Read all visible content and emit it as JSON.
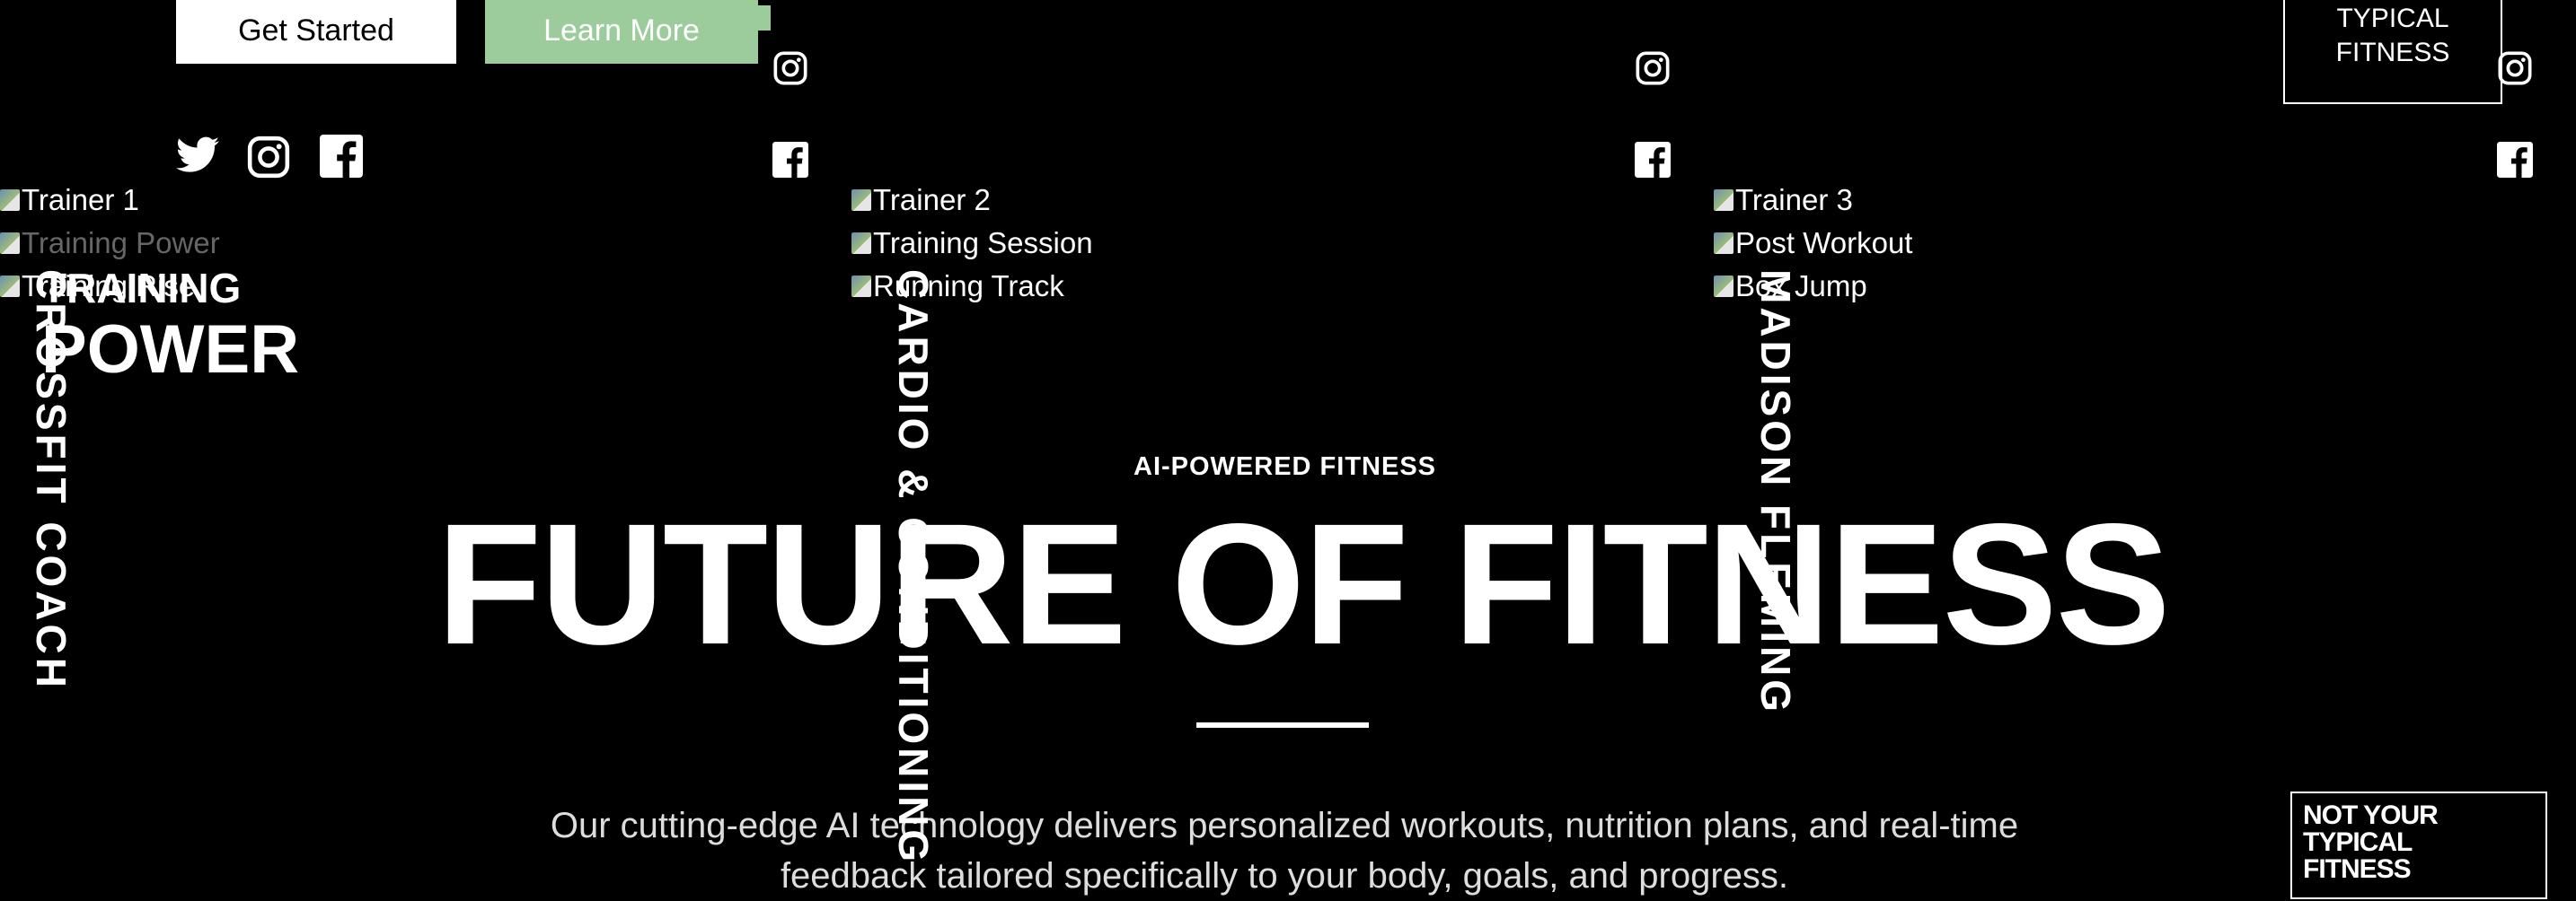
{
  "buttons": {
    "primary_label": "Get Started",
    "secondary_label": "Learn More"
  },
  "social_icons": [
    "twitter-icon",
    "instagram-icon",
    "facebook-icon"
  ],
  "trainers": [
    {
      "images": [
        "Trainer 1",
        "Training Power",
        "Training Rise"
      ],
      "vertical_label": "CROSSFIT COACH",
      "title_line1": "TRAINING",
      "title_line2": "POWER"
    },
    {
      "images": [
        "Trainer 2",
        "Training Session",
        "Running Track"
      ],
      "vertical_label": "CARDIO & CONDITIONING"
    },
    {
      "images": [
        "Trainer 3",
        "Post Workout",
        "Box Jump"
      ],
      "vertical_label": "MADISON FLEMING"
    }
  ],
  "hero": {
    "eyebrow": "AI-POWERED FITNESS",
    "title": "FUTURE OF FITNESS",
    "subtext": "Our cutting-edge AI technology delivers personalized workouts, nutrition plans, and real-time feedback tailored specifically to your body, goals, and progress."
  },
  "badge_top": {
    "line1": "TYPICAL",
    "line2": "FITNESS"
  },
  "badge_bottom": {
    "line1": "NOT YOUR",
    "line2": "TYPICAL",
    "line3": "FITNESS"
  },
  "colors": {
    "background": "#000000",
    "accent": "#9ccc9c",
    "text": "#ffffff"
  }
}
